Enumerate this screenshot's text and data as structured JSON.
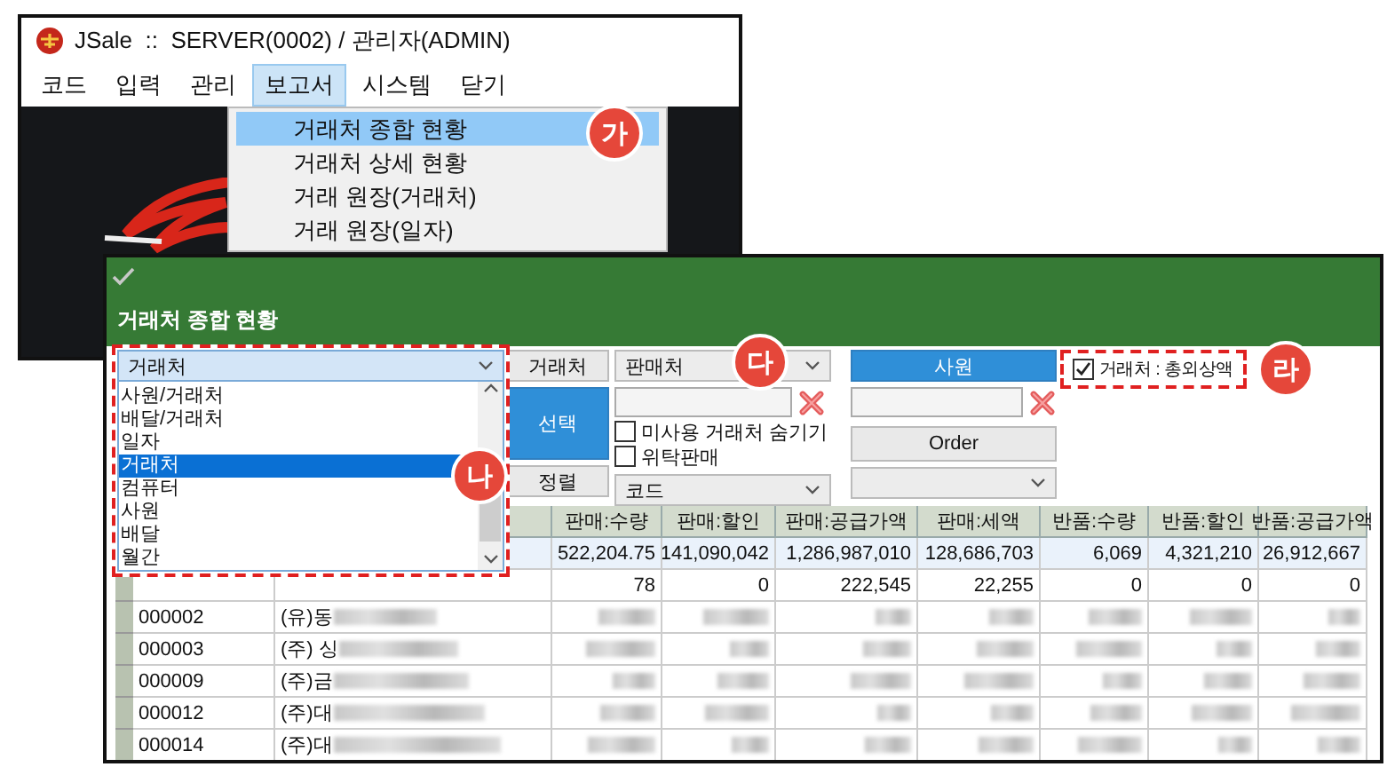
{
  "main_window": {
    "title": "JSale  ::  SERVER(0002) / 관리자(ADMIN)",
    "menu": [
      {
        "label": "코드",
        "selected": false
      },
      {
        "label": "입력",
        "selected": false
      },
      {
        "label": "관리",
        "selected": false
      },
      {
        "label": "보고서",
        "selected": true
      },
      {
        "label": "시스템",
        "selected": false
      },
      {
        "label": "닫기",
        "selected": false
      }
    ],
    "dropdown": [
      {
        "label": "거래처 종합 현황",
        "selected": true
      },
      {
        "label": "거래처 상세 현황",
        "selected": false
      },
      {
        "label": "거래 원장(거래처)",
        "selected": false
      },
      {
        "label": "거래 원장(일자)",
        "selected": false
      }
    ]
  },
  "report_window": {
    "title": "거래처 종합 현황",
    "group_by": {
      "value": "거래처",
      "options": [
        {
          "label": "사원/거래처",
          "selected": false
        },
        {
          "label": "배달/거래처",
          "selected": false
        },
        {
          "label": "일자",
          "selected": false
        },
        {
          "label": "거래처",
          "selected": true
        },
        {
          "label": "컴퓨터",
          "selected": false
        },
        {
          "label": "사원",
          "selected": false
        },
        {
          "label": "배달",
          "selected": false
        },
        {
          "label": "월간",
          "selected": false
        }
      ]
    },
    "customer_label": "거래처",
    "customer_type": "판매처",
    "select_button": "선택",
    "filters": [
      {
        "label": "미사용 거래처 숨기기",
        "checked": false
      },
      {
        "label": "위탁판매",
        "checked": false
      }
    ],
    "sort_label": "정렬",
    "sort_value": "코드",
    "employee_button": "사원",
    "order_button": "Order",
    "balance_option": {
      "label": "거래처 : 총외상액",
      "checked": true
    },
    "table": {
      "columns": [
        "판매:수량",
        "판매:할인",
        "판매:공급가액",
        "판매:세액",
        "반품:수량",
        "반품:할인",
        "반품:공급가액"
      ],
      "rows": [
        {
          "kind": "total",
          "values": [
            "522,204.75",
            "141,090,042",
            "1,286,987,010",
            "128,686,703",
            "6,069",
            "4,321,210",
            "26,912,667"
          ]
        },
        {
          "kind": "plain",
          "values": [
            "78",
            "0",
            "222,545",
            "22,255",
            "0",
            "0",
            "0"
          ]
        },
        {
          "kind": "masked",
          "code": "000002",
          "name": "(유)동"
        },
        {
          "kind": "masked",
          "code": "000003",
          "name": "(주) 싱"
        },
        {
          "kind": "masked",
          "code": "000009",
          "name": "(주)금"
        },
        {
          "kind": "masked",
          "code": "000012",
          "name": "(주)대"
        },
        {
          "kind": "masked",
          "code": "000014",
          "name": "(주)대"
        }
      ]
    }
  },
  "callouts": [
    "가",
    "나",
    "다",
    "라"
  ]
}
